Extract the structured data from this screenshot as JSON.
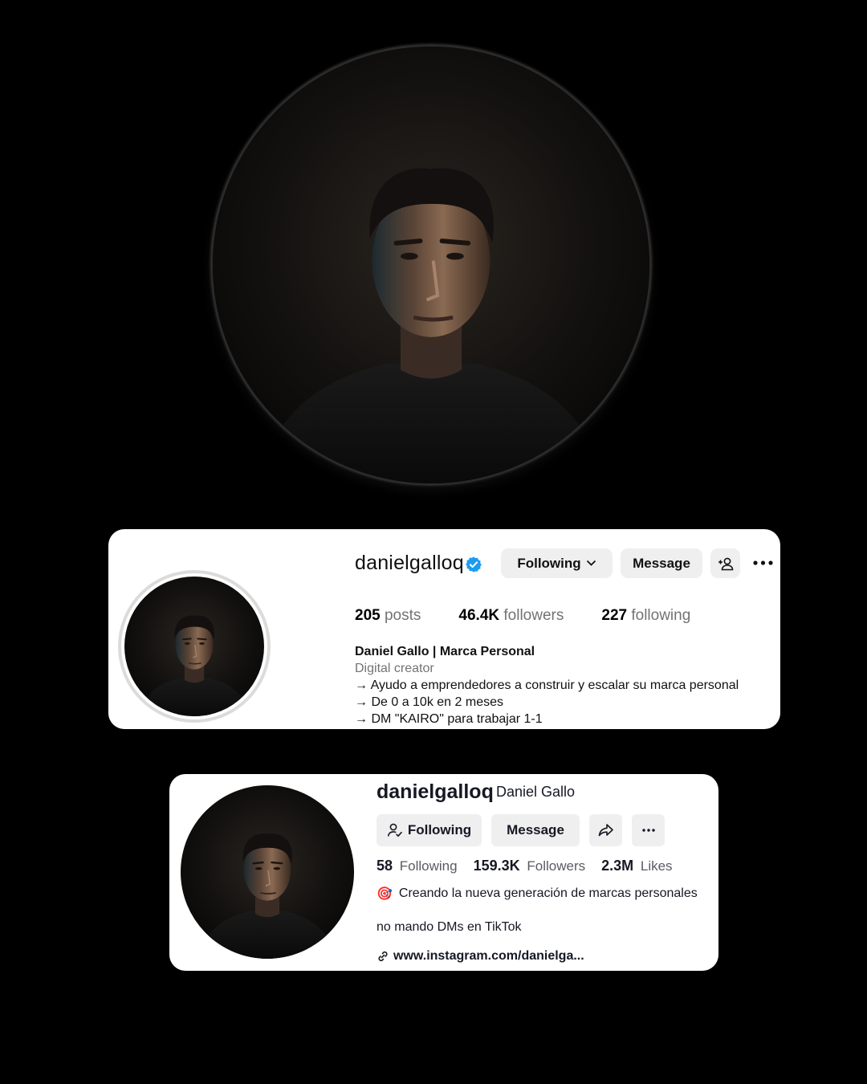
{
  "instagram": {
    "username": "danielgalloq",
    "buttons": {
      "following": "Following",
      "message": "Message"
    },
    "stats": [
      {
        "value": "205",
        "label": "posts"
      },
      {
        "value": "46.4K",
        "label": "followers"
      },
      {
        "value": "227",
        "label": "following"
      }
    ],
    "bio": {
      "name": "Daniel Gallo | Marca Personal",
      "category": "Digital creator",
      "lines": [
        "→ Ayudo a emprendedores a construir y escalar su marca personal",
        "→ De 0 a 10k en 2 meses",
        "→ DM \"KAIRO\" para trabajar 1-1"
      ]
    },
    "colors": {
      "verified": "#1d9bf0",
      "button_bg": "#efefef",
      "muted": "#737373"
    }
  },
  "tiktok": {
    "username": "danielgalloq",
    "nickname": "Daniel Gallo",
    "buttons": {
      "following": "Following",
      "message": "Message"
    },
    "stats": [
      {
        "value": "58",
        "label": "Following"
      },
      {
        "value": "159.3K",
        "label": "Followers"
      },
      {
        "value": "2.3M",
        "label": "Likes"
      }
    ],
    "bio": {
      "emoji": "🎯",
      "line1": "Creando la nueva generación de marcas personales",
      "line2": "no mando DMs en TikTok"
    },
    "link": "www.instagram.com/danielga...",
    "colors": {
      "button_bg": "#efefef",
      "text": "#161823"
    }
  }
}
